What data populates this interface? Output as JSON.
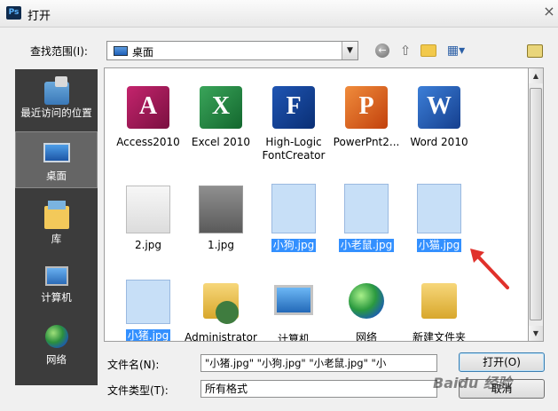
{
  "window": {
    "app_icon_label": "Ps",
    "title": "打开",
    "close_glyph": "×"
  },
  "toolbar": {
    "lookin_label": "查找范围(I):",
    "lookin_value": "桌面",
    "dropdown_glyph": "▼",
    "back_glyph": "←",
    "up_glyph": "⇧",
    "view_glyph": "▦▾"
  },
  "places": [
    {
      "label": "最近访问的位置",
      "icon": "recent-places-icon"
    },
    {
      "label": "桌面",
      "icon": "desktop-icon",
      "selected": true
    },
    {
      "label": "库",
      "icon": "libraries-icon"
    },
    {
      "label": "计算机",
      "icon": "computer-icon"
    },
    {
      "label": "网络",
      "icon": "network-icon"
    }
  ],
  "files": [
    {
      "label": "Access2010",
      "icon": "access-icon",
      "glyph": "A",
      "selected": false
    },
    {
      "label": "Excel 2010",
      "icon": "excel-icon",
      "glyph": "X",
      "selected": false
    },
    {
      "label": "High-Logic FontCreator",
      "icon": "fontcreator-icon",
      "glyph": "F",
      "selected": false
    },
    {
      "label": "PowerPnt2...",
      "icon": "powerpoint-icon",
      "glyph": "P",
      "selected": false
    },
    {
      "label": "Word 2010",
      "icon": "word-icon",
      "glyph": "W",
      "selected": false
    },
    {
      "label": "2.jpg",
      "icon": "image-thumbnail-icon",
      "selected": false
    },
    {
      "label": "1.jpg",
      "icon": "image-thumbnail-icon",
      "selected": false
    },
    {
      "label": "小狗.jpg",
      "icon": "dog-cartoon-thumbnail",
      "selected": true
    },
    {
      "label": "小老鼠.jpg",
      "icon": "mouse-cartoon-thumbnail",
      "selected": true
    },
    {
      "label": "小猫.jpg",
      "icon": "cat-cartoon-thumbnail",
      "selected": true
    },
    {
      "label": "小猪.jpg",
      "icon": "pig-cartoon-thumbnail",
      "selected": true
    },
    {
      "label": "Administrator",
      "icon": "user-folder-icon",
      "selected": false
    },
    {
      "label": "计算机",
      "icon": "computer-icon",
      "selected": false
    },
    {
      "label": "网络",
      "icon": "network-icon",
      "selected": false
    },
    {
      "label": "新建文件夹",
      "icon": "folder-icon",
      "selected": false
    }
  ],
  "footer": {
    "filename_label": "文件名(N):",
    "filename_value": "\"小猪.jpg\" \"小狗.jpg\" \"小老鼠.jpg\" \"小",
    "filetype_label": "文件类型(T):",
    "filetype_value": "所有格式",
    "open_button": "打开(O)",
    "cancel_button": "取消"
  },
  "scrollbar": {
    "up_glyph": "▲",
    "down_glyph": "▼"
  },
  "watermark": "Baidu 经验",
  "colors": {
    "selection": "#3390ff",
    "places_bg": "#3c3c3c",
    "annotation_arrow": "#e0312b"
  }
}
